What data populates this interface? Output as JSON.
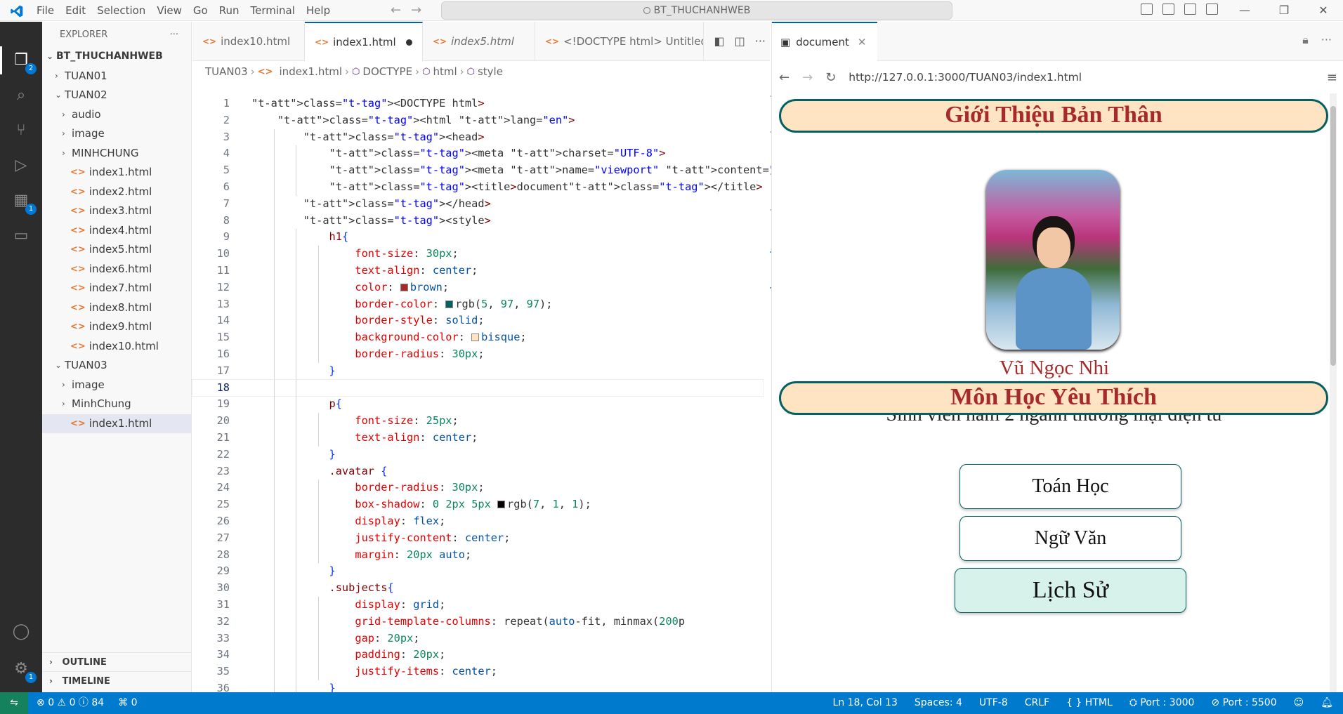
{
  "menu": [
    "File",
    "Edit",
    "Selection",
    "View",
    "Go",
    "Run",
    "Terminal",
    "Help"
  ],
  "command_center": "BT_THUCHANHWEB",
  "explorer": {
    "title": "EXPLORER",
    "root": "BT_THUCHANHWEB",
    "tuan01": "TUAN01",
    "tuan02": "TUAN02",
    "tuan02_items": [
      "audio",
      "image",
      "MINHCHUNG",
      "index1.html",
      "index2.html",
      "index3.html",
      "index4.html",
      "index5.html",
      "index6.html",
      "index7.html",
      "index8.html",
      "index9.html",
      "index10.html"
    ],
    "tuan03": "TUAN03",
    "tuan03_items": [
      "image",
      "MinhChung",
      "index1.html"
    ],
    "outline": "OUTLINE",
    "timeline": "TIMELINE"
  },
  "activity_badges": {
    "explorer": "2",
    "extensions": "1",
    "settings": "1"
  },
  "tabs": [
    {
      "label": "index10.html"
    },
    {
      "label": "index1.html"
    },
    {
      "label": "index5.html"
    },
    {
      "label": "<!DOCTYPE html>  Untitled"
    }
  ],
  "breadcrumb": [
    "TUAN03",
    "index1.html",
    "DOCTYPE",
    "html",
    "style"
  ],
  "code_lines": [
    "<DOCTYPE html>",
    "    <html lang=\"en\">",
    "        <head>",
    "            <meta charset=\"UTF-8\">",
    "            <meta name=\"viewport\" content=\"width=device-width, init",
    "            <title>document</title>",
    "        </head>",
    "        <style>",
    "            h1{",
    "                font-size: 30px;",
    "                text-align: center;",
    "                color: brown;",
    "                border-color: rgb(5, 97, 97);",
    "                border-style: solid;",
    "                background-color: bisque;",
    "                border-radius: 30px;",
    "            }",
    "",
    "            p{",
    "                font-size: 25px;",
    "                text-align: center;",
    "            }",
    "            .avatar {",
    "                border-radius: 30px;",
    "                box-shadow: 0 2px 5px rgb(7, 1, 1);",
    "                display: flex;",
    "                justify-content: center;",
    "                margin: 20px auto;",
    "            }",
    "            .subjects{",
    "                display: grid;",
    "                grid-template-columns: repeat(auto-fit, minmax(200p",
    "                gap: 20px;",
    "                padding: 20px;",
    "                justify-items: center;",
    "            }",
    "            .subjects li{"
  ],
  "swatches": {
    "brown": "#a52a2a",
    "teal": "#056161",
    "bisque": "#ffe4c4",
    "black": "#070101"
  },
  "preview": {
    "tab_title": "document",
    "url": "http://127.0.0.1:3000/TUAN03/index1.html",
    "heading1": "Giới Thiệu Bản Thân",
    "name": "Vũ Ngọc Nhi",
    "description": "Sinh viên năm 2 ngành thương mại điện tử",
    "heading2": "Môn Học Yêu Thích",
    "subjects": [
      "Toán Học",
      "Ngữ Văn",
      "Lịch Sử"
    ]
  },
  "status": {
    "errors": "0",
    "warnings": "0",
    "info": "84",
    "ports_count": "0",
    "position": "Ln 18, Col 13",
    "spaces": "Spaces: 4",
    "encoding": "UTF-8",
    "eol": "CRLF",
    "language": "HTML",
    "port1": "Port : 3000",
    "port2": "Port : 5500"
  }
}
